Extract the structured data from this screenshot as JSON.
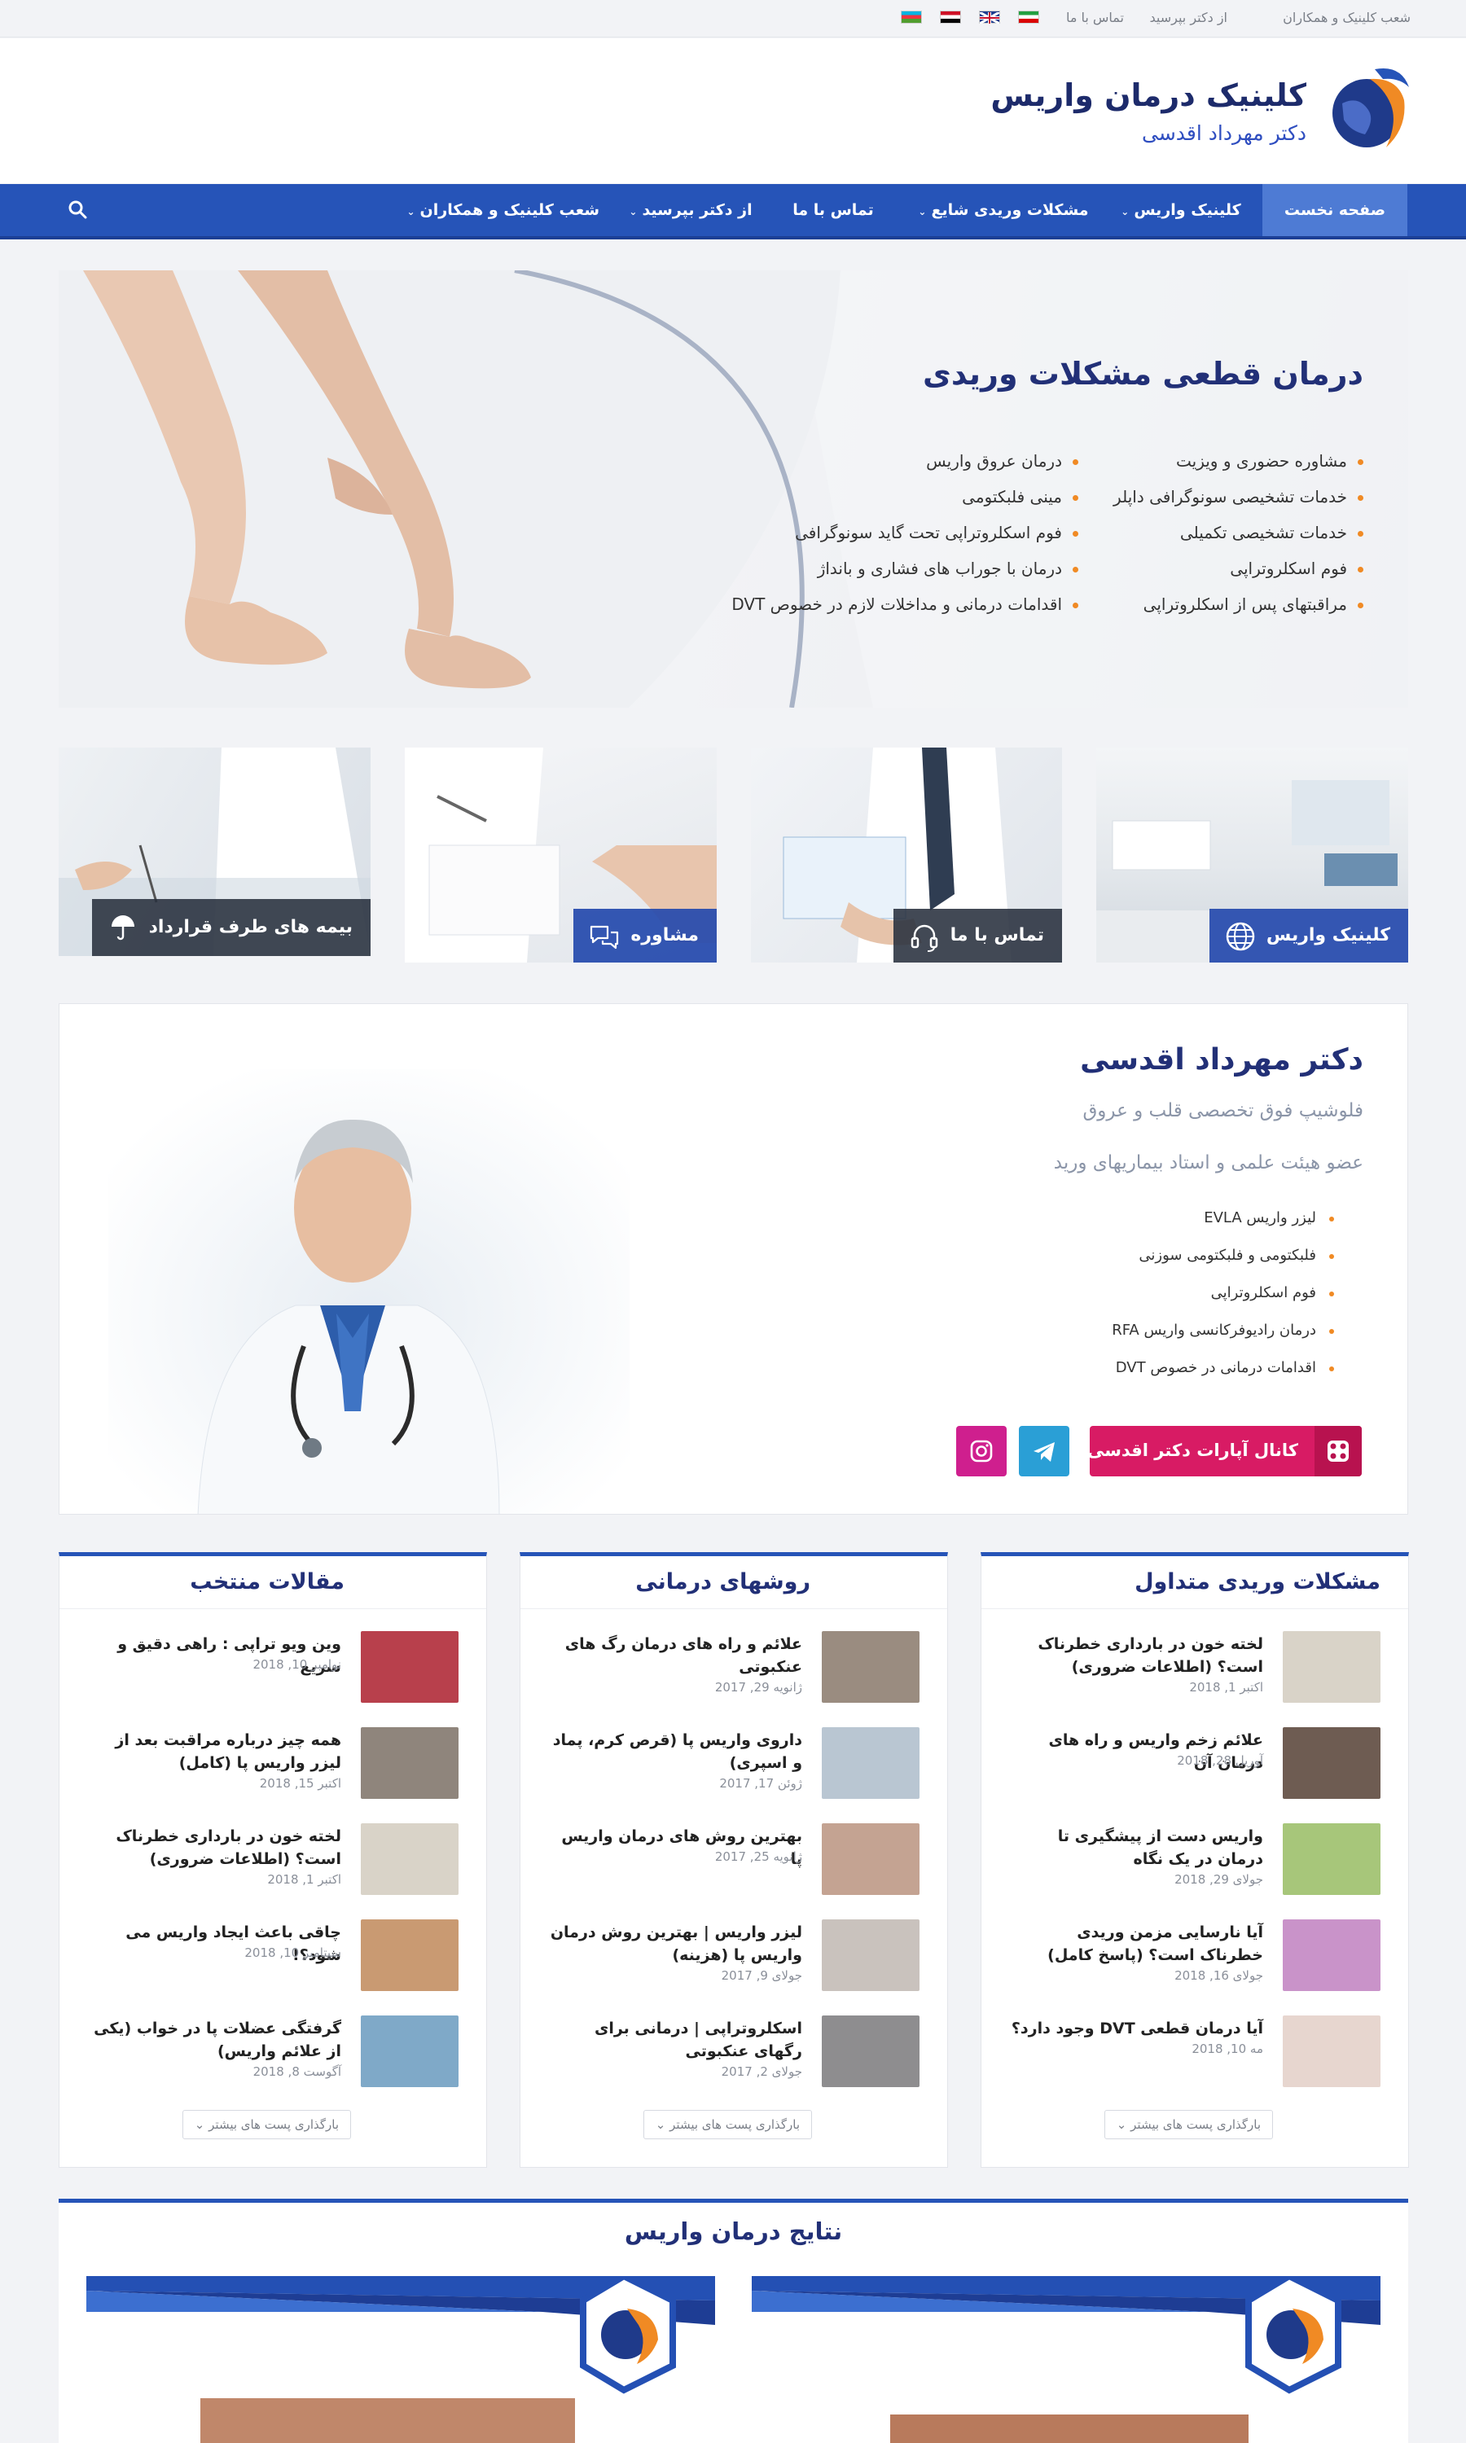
{
  "topbar": {
    "links": [
      "شعب کلینیک و همکاران",
      "از دکتر بپرسید",
      "تماس با ما"
    ],
    "flags": [
      "iran-flag",
      "uk-flag",
      "egypt-flag",
      "azerbaijan-flag"
    ]
  },
  "header": {
    "title": "کلینیک درمان واریس",
    "subtitle": "دکتر مهرداد اقدسی"
  },
  "nav": {
    "items": [
      {
        "label": "صفحه نخست",
        "active": true,
        "dropdown": false
      },
      {
        "label": "کلینیک واریس",
        "active": false,
        "dropdown": true
      },
      {
        "label": "مشکلات وریدی شایع",
        "active": false,
        "dropdown": true
      },
      {
        "label": "تماس با ما",
        "active": false,
        "dropdown": false
      },
      {
        "label": "از دکتر بپرسید",
        "active": false,
        "dropdown": true
      },
      {
        "label": "شعب کلینیک و همکاران",
        "active": false,
        "dropdown": true
      }
    ]
  },
  "hero": {
    "title": "درمان قطعی مشکلات وریدی",
    "col_right": [
      "مشاوره حضوری و ویزیت",
      "خدمات تشخیصی سونوگرافی داپلر",
      "خدمات تشخیصی تکمیلی",
      "فوم اسکلروتراپی",
      "مراقبتهای پس از اسکلروتراپی"
    ],
    "col_left": [
      "درمان عروق واریس",
      "مینی فلبکتومی",
      "فوم اسکلروتراپی تحت گاید سونوگرافی",
      "درمان با جوراب های فشاری و بانداژ",
      "اقدامات درمانی و مداخلات لازم در خصوص DVT"
    ]
  },
  "tiles": [
    {
      "label": "کلینیک واریس",
      "icon": "globe-icon"
    },
    {
      "label": "تماس با ما",
      "icon": "headset-icon"
    },
    {
      "label": "مشاوره",
      "icon": "chat-bubbles-icon"
    },
    {
      "label": "بیمه های طرف قرارداد",
      "icon": "umbrella-icon"
    }
  ],
  "doctor": {
    "name": "دکتر مهرداد اقدسی",
    "title": "فلوشیپ فوق تخصصی قلب و عروق",
    "title2": "عضو هیئت علمی و استاد بیماریهای ورید",
    "services": [
      "لیزر واریس EVLA",
      "فلبکتومی و فلبکتومی سوزنی",
      "فوم اسکلروتراپی",
      "درمان رادیوفرکانسی واریس RFA",
      "اقدامات درمانی در خصوص DVT"
    ],
    "aparat_label": "کانال آپارات دکتر اقدسی"
  },
  "columns": [
    {
      "title": "مشکلات وریدی متداول",
      "articles": [
        {
          "title": "لخته خون در بارداری خطرناک است؟ (اطلاعات ضروری)",
          "date": "اکتبر 1, 2018",
          "thumb": "#d9d3c8"
        },
        {
          "title": "علائم زخم واریس و راه های درمان آن",
          "date": "آوریل 28, 2018",
          "thumb": "#6e5c52"
        },
        {
          "title": "واریس دست از پیشگیری تا درمان در یک نگاه",
          "date": "جولای 29, 2018",
          "thumb": "#a7c67a"
        },
        {
          "title": "آیا نارسایی مزمن وریدی خطرناک است؟ (پاسخ کامل)",
          "date": "جولای 16, 2018",
          "thumb": "#c993c9"
        },
        {
          "title": "آیا درمان قطعی DVT وجود دارد؟",
          "date": "مه 10, 2018",
          "thumb": "#e7d6cf"
        }
      ],
      "loadmore": "بارگذاری پست های بیشتر"
    },
    {
      "title": "روشهای درمانی",
      "articles": [
        {
          "title": "علائم و راه های درمان رگ های عنکبوتی",
          "date": "ژانویه 29, 2017",
          "thumb": "#9a8c80"
        },
        {
          "title": "داروی واریس پا (قرص کرم، پماد و اسپری)",
          "date": "ژوئن 17, 2017",
          "thumb": "#b9c6d2"
        },
        {
          "title": "بهترین روش های درمان واریس پا",
          "date": "ژانویه 25, 2017",
          "thumb": "#c4a392"
        },
        {
          "title": "لیزر واریس | بهترین روش درمان واریس پا (هزینه)",
          "date": "جولای 9, 2017",
          "thumb": "#c9c2bd"
        },
        {
          "title": "اسکلروتراپی | درمانی برای رگهای عنکبوتی",
          "date": "جولای 2, 2017",
          "thumb": "#8e8d8f"
        }
      ],
      "loadmore": "بارگذاری پست های بیشتر"
    },
    {
      "title": "مقالات منتخب",
      "articles": [
        {
          "title": "وین ویو تراپی : راهی دقیق و سریع",
          "date": "نوامبر 10, 2018",
          "thumb": "#b8404c"
        },
        {
          "title": "همه چیز درباره مراقبت بعد از لیزر واریس پا (کامل)",
          "date": "اکتبر 15, 2018",
          "thumb": "#8f857c"
        },
        {
          "title": "لخته خون در بارداری خطرناک است؟ (اطلاعات ضروری)",
          "date": "اکتبر 1, 2018",
          "thumb": "#d9d3c8"
        },
        {
          "title": "چاقی باعث ایجاد واریس می شود؟!",
          "date": "سپتامبر 10, 2018",
          "thumb": "#c99a72"
        },
        {
          "title": "گرفتگی عضلات پا در خواب (یکی از علائم واریس)",
          "date": "آگوست 8, 2018",
          "thumb": "#7fa9c8"
        }
      ],
      "loadmore": "بارگذاری پست های بیشتر"
    }
  ],
  "results": {
    "title": "نتایج درمان واریس"
  },
  "colors": {
    "nav_blue": "#2654b8",
    "brand_navy": "#223077",
    "accent_orange": "#f08a24",
    "aparat_pink": "#d81b64",
    "telegram_blue": "#2a9fd6",
    "instagram_magenta": "#cf1f8e"
  }
}
